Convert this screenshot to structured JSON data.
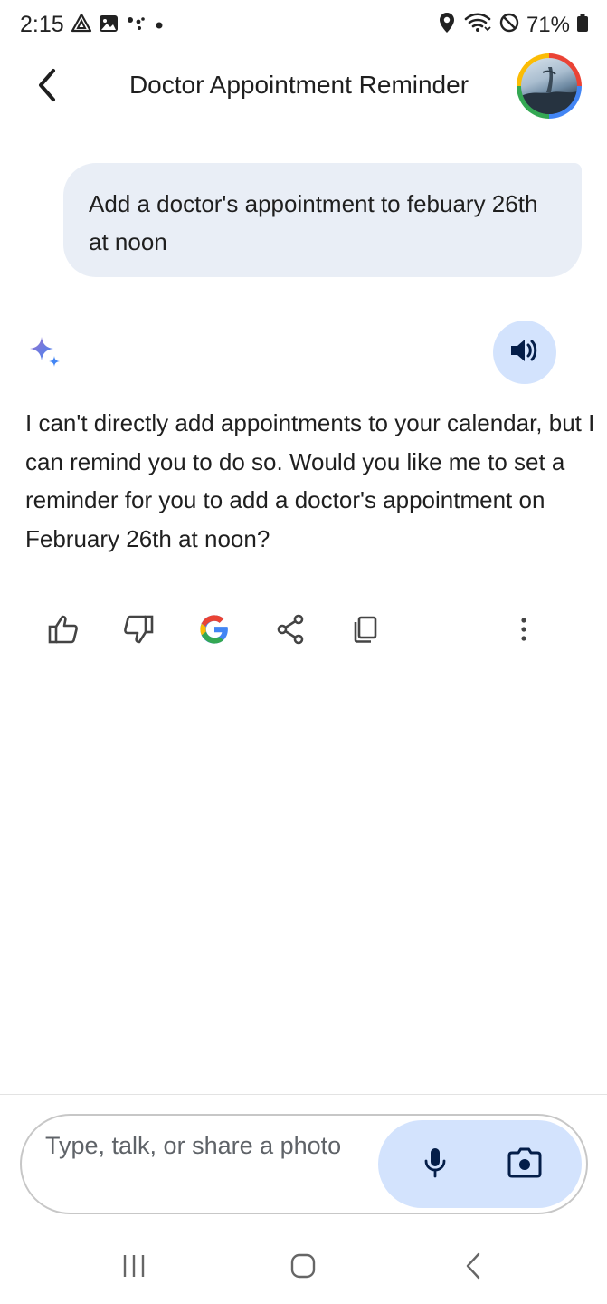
{
  "status_bar": {
    "time": "2:15",
    "battery": "71%",
    "left_icons": [
      "navigation-app-icon",
      "gallery-icon",
      "assistant-dots-icon",
      "notification-dot-icon"
    ],
    "right_icons": [
      "location-icon",
      "wifi-icon",
      "do-not-disturb-icon",
      "battery-icon"
    ]
  },
  "header": {
    "title": "Doctor Appointment Reminder",
    "back_icon": "back-arrow-icon",
    "avatar": "profile-avatar"
  },
  "conversation": {
    "user_message": "Add a doctor's appointment to febuary 26th at noon",
    "response": {
      "icon": "gemini-sparkle-icon",
      "text": "I can't directly add appointments to your calendar, but I can remind you to do so.  Would you like me to set a reminder for you to add a doctor's appointment on February 26th at noon?",
      "listen_icon": "speaker-icon",
      "actions": [
        "thumbs-up-icon",
        "thumbs-down-icon",
        "google-search-icon",
        "share-icon",
        "copy-icon",
        "more-vert-icon"
      ]
    }
  },
  "input": {
    "placeholder": "Type, talk, or share a photo",
    "mic_icon": "mic-icon",
    "camera_icon": "camera-icon"
  },
  "nav_bar": [
    "recent-apps-icon",
    "home-icon",
    "back-icon"
  ],
  "colors": {
    "user_bubble": "#e9eef6",
    "accent_light": "#d3e3fd",
    "text": "#1f1f1f",
    "google_blue": "#4285f4",
    "google_red": "#ea4335",
    "google_yellow": "#fbbc05",
    "google_green": "#34a853"
  }
}
